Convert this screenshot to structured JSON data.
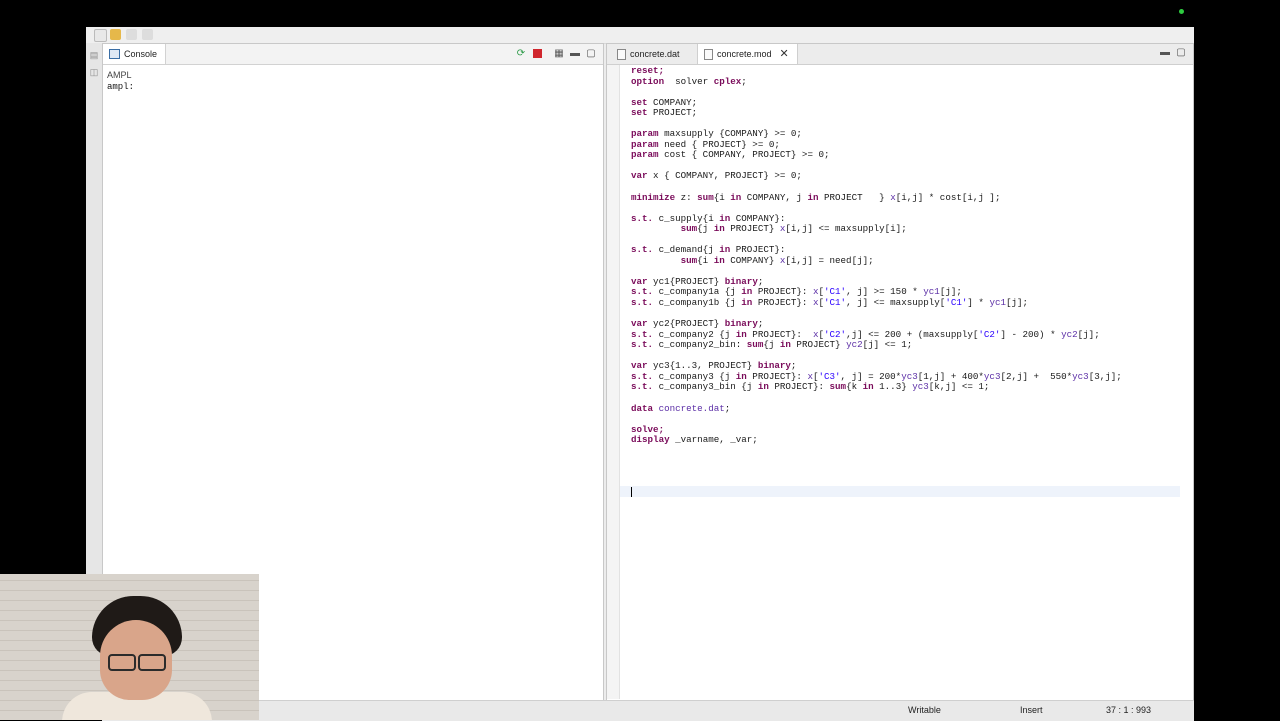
{
  "console": {
    "tab_label": "Console",
    "ampl_label": "AMPL",
    "prompt": "ampl:"
  },
  "editor": {
    "tabs": [
      {
        "label": "concrete.dat",
        "active": false
      },
      {
        "label": "concrete.mod",
        "active": true
      }
    ],
    "lines": [
      [
        [
          "kw",
          "reset;"
        ]
      ],
      [
        [
          "kw",
          "option"
        ],
        [
          "",
          "  solver "
        ],
        [
          "kw",
          "cplex"
        ],
        [
          "",
          ";"
        ]
      ],
      [
        [
          "",
          ""
        ]
      ],
      [
        [
          "kw",
          "set"
        ],
        [
          "",
          " COMPANY;"
        ]
      ],
      [
        [
          "kw",
          "set"
        ],
        [
          "",
          " PROJECT;"
        ]
      ],
      [
        [
          "",
          ""
        ]
      ],
      [
        [
          "kw",
          "param"
        ],
        [
          "",
          " maxsupply {COMPANY} >= 0;"
        ]
      ],
      [
        [
          "kw",
          "param"
        ],
        [
          "",
          " need { PROJECT} >= 0;"
        ]
      ],
      [
        [
          "kw",
          "param"
        ],
        [
          "",
          " cost { COMPANY, PROJECT} >= 0;"
        ]
      ],
      [
        [
          "",
          ""
        ]
      ],
      [
        [
          "kw",
          "var"
        ],
        [
          "",
          " x { COMPANY, PROJECT} >= 0;"
        ]
      ],
      [
        [
          "",
          ""
        ]
      ],
      [
        [
          "kw",
          "minimize"
        ],
        [
          "",
          " z: "
        ],
        [
          "kw",
          "sum"
        ],
        [
          "",
          "{i "
        ],
        [
          "kw",
          "in"
        ],
        [
          "",
          " COMPANY, j "
        ],
        [
          "kw",
          "in"
        ],
        [
          "",
          " PROJECT   } "
        ],
        [
          "sym",
          "x"
        ],
        [
          "",
          "[i,j] * cost[i,j ];"
        ]
      ],
      [
        [
          "",
          ""
        ]
      ],
      [
        [
          "kw",
          "s.t."
        ],
        [
          "",
          " c_supply{i "
        ],
        [
          "kw",
          "in"
        ],
        [
          "",
          " COMPANY}:"
        ]
      ],
      [
        [
          "",
          "         "
        ],
        [
          "kw",
          "sum"
        ],
        [
          "",
          "{j "
        ],
        [
          "kw",
          "in"
        ],
        [
          "",
          " PROJECT} "
        ],
        [
          "sym",
          "x"
        ],
        [
          "",
          "[i,j] <= maxsupply[i];"
        ]
      ],
      [
        [
          "",
          ""
        ]
      ],
      [
        [
          "kw",
          "s.t."
        ],
        [
          "",
          " c_demand{j "
        ],
        [
          "kw",
          "in"
        ],
        [
          "",
          " PROJECT}:"
        ]
      ],
      [
        [
          "",
          "         "
        ],
        [
          "kw",
          "sum"
        ],
        [
          "",
          "{i "
        ],
        [
          "kw",
          "in"
        ],
        [
          "",
          " COMPANY} "
        ],
        [
          "sym",
          "x"
        ],
        [
          "",
          "[i,j] = need[j];"
        ]
      ],
      [
        [
          "",
          ""
        ]
      ],
      [
        [
          "kw",
          "var"
        ],
        [
          "",
          " yc1{PROJECT} "
        ],
        [
          "kw",
          "binary"
        ],
        [
          "",
          ";"
        ]
      ],
      [
        [
          "kw",
          "s.t."
        ],
        [
          "",
          " c_company1a {j "
        ],
        [
          "kw",
          "in"
        ],
        [
          "",
          " PROJECT}: "
        ],
        [
          "sym",
          "x"
        ],
        [
          "",
          "["
        ],
        [
          "str",
          "'C1'"
        ],
        [
          "",
          ", j] >= 150 * "
        ],
        [
          "sym",
          "yc1"
        ],
        [
          "",
          "[j];"
        ]
      ],
      [
        [
          "kw",
          "s.t."
        ],
        [
          "",
          " c_company1b {j "
        ],
        [
          "kw",
          "in"
        ],
        [
          "",
          " PROJECT}: "
        ],
        [
          "sym",
          "x"
        ],
        [
          "",
          "["
        ],
        [
          "str",
          "'C1'"
        ],
        [
          "",
          ", j] <= maxsupply["
        ],
        [
          "str",
          "'C1'"
        ],
        [
          "",
          "] * "
        ],
        [
          "sym",
          "yc1"
        ],
        [
          "",
          "[j];"
        ]
      ],
      [
        [
          "",
          ""
        ]
      ],
      [
        [
          "kw",
          "var"
        ],
        [
          "",
          " yc2{PROJECT} "
        ],
        [
          "kw",
          "binary"
        ],
        [
          "",
          ";"
        ]
      ],
      [
        [
          "kw",
          "s.t."
        ],
        [
          "",
          " c_company2 {j "
        ],
        [
          "kw",
          "in"
        ],
        [
          "",
          " PROJECT}:  "
        ],
        [
          "sym",
          "x"
        ],
        [
          "",
          "["
        ],
        [
          "str",
          "'C2'"
        ],
        [
          "",
          ",j] <= 200 + (maxsupply["
        ],
        [
          "str",
          "'C2'"
        ],
        [
          "",
          "] - 200) * "
        ],
        [
          "sym",
          "yc2"
        ],
        [
          "",
          "[j];"
        ]
      ],
      [
        [
          "kw",
          "s.t."
        ],
        [
          "",
          " c_company2_bin: "
        ],
        [
          "kw",
          "sum"
        ],
        [
          "",
          "{j "
        ],
        [
          "kw",
          "in"
        ],
        [
          "",
          " PROJECT} "
        ],
        [
          "sym",
          "yc2"
        ],
        [
          "",
          "[j] <= 1;"
        ]
      ],
      [
        [
          "",
          ""
        ]
      ],
      [
        [
          "kw",
          "var"
        ],
        [
          "",
          " yc3{1..3, PROJECT} "
        ],
        [
          "kw",
          "binary"
        ],
        [
          "",
          ";"
        ]
      ],
      [
        [
          "kw",
          "s.t."
        ],
        [
          "",
          " c_company3 {j "
        ],
        [
          "kw",
          "in"
        ],
        [
          "",
          " PROJECT}: "
        ],
        [
          "sym",
          "x"
        ],
        [
          "",
          "["
        ],
        [
          "str",
          "'C3'"
        ],
        [
          "",
          ", j] = 200*"
        ],
        [
          "sym",
          "yc3"
        ],
        [
          "",
          "[1,j] + 400*"
        ],
        [
          "sym",
          "yc3"
        ],
        [
          "",
          "[2,j] +  550*"
        ],
        [
          "sym",
          "yc3"
        ],
        [
          "",
          "[3,j];"
        ]
      ],
      [
        [
          "kw",
          "s.t."
        ],
        [
          "",
          " c_company3_bin {j "
        ],
        [
          "kw",
          "in"
        ],
        [
          "",
          " PROJECT}: "
        ],
        [
          "kw",
          "sum"
        ],
        [
          "",
          "{k "
        ],
        [
          "kw",
          "in"
        ],
        [
          "",
          " 1..3} "
        ],
        [
          "sym",
          "yc3"
        ],
        [
          "",
          "[k,j] <= 1;"
        ]
      ],
      [
        [
          "",
          ""
        ]
      ],
      [
        [
          "kw",
          "data"
        ],
        [
          "",
          " "
        ],
        [
          "sym",
          "concrete.dat"
        ],
        [
          "",
          ";"
        ]
      ],
      [
        [
          "",
          ""
        ]
      ],
      [
        [
          "kw",
          "solve;"
        ]
      ],
      [
        [
          "kw",
          "display"
        ],
        [
          "",
          " _varname, _var;"
        ]
      ],
      [
        [
          "",
          ""
        ]
      ]
    ]
  },
  "status": {
    "mode": "Writable",
    "insert": "Insert",
    "position": "37 : 1 : 993"
  }
}
